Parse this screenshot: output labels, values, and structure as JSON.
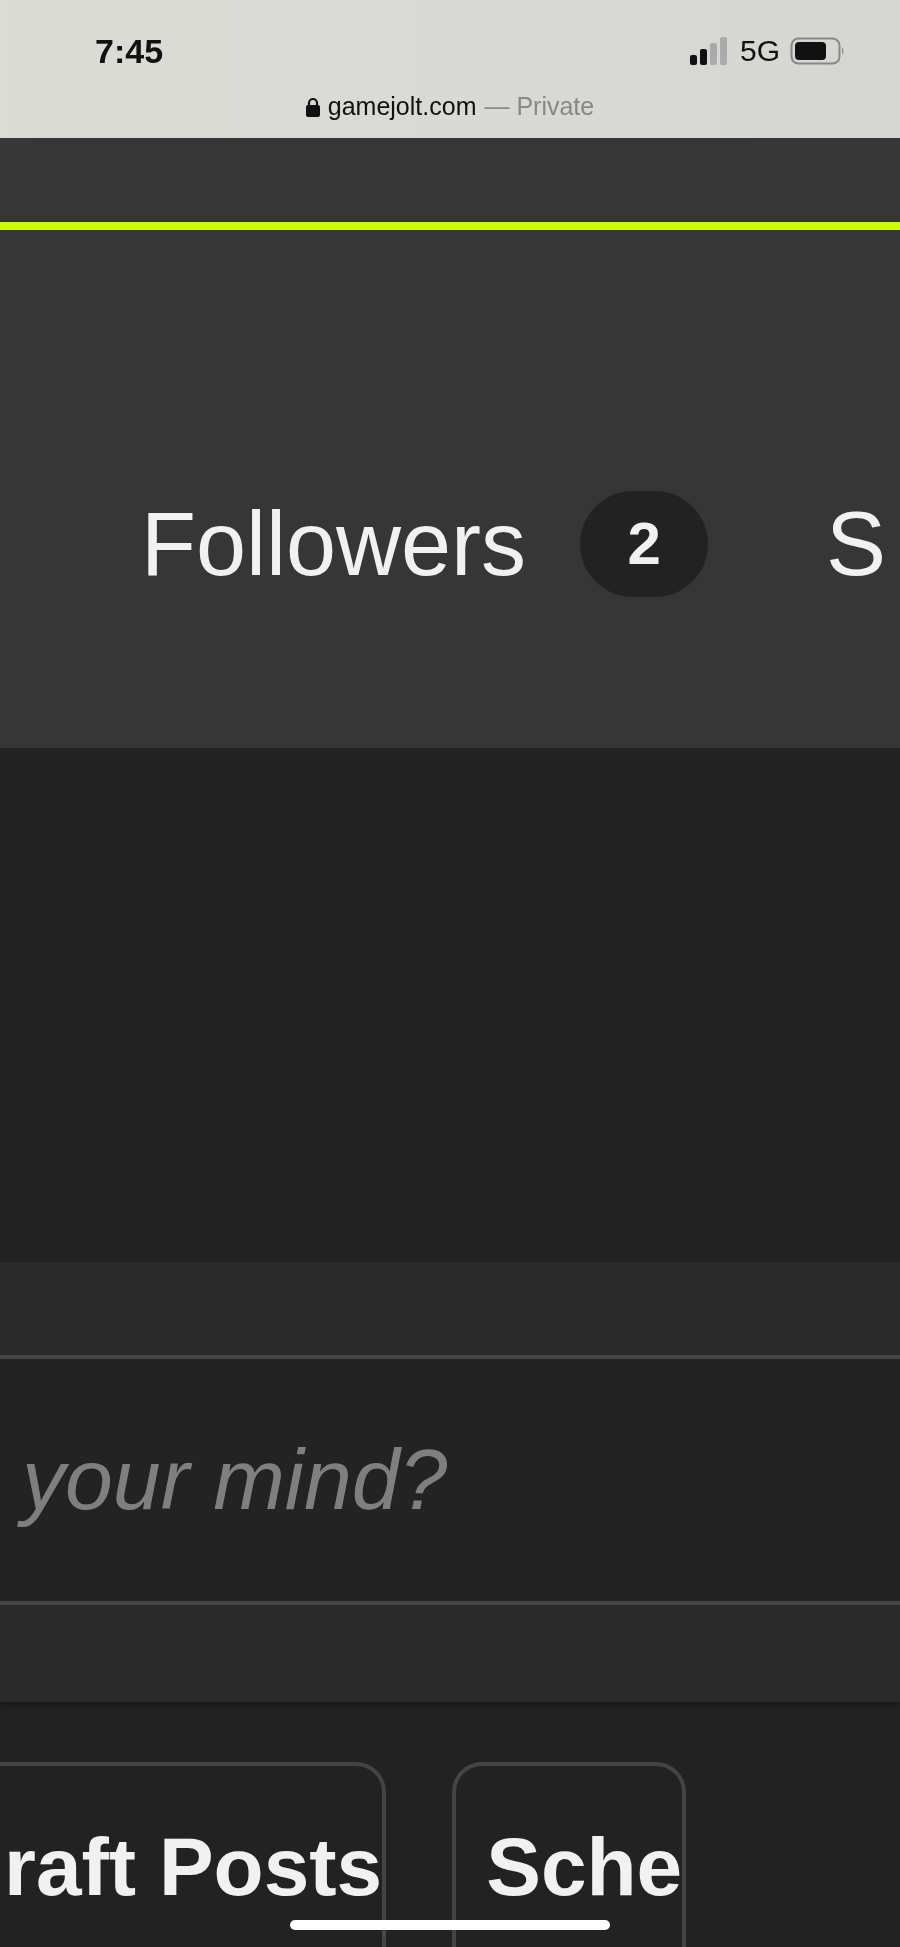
{
  "status_bar": {
    "time": "7:45",
    "network": "5G"
  },
  "address_bar": {
    "domain": "gamejolt.com",
    "mode": "— Private"
  },
  "profile_nav": {
    "tabs": [
      {
        "label": "Followers",
        "count": "2"
      },
      {
        "label": "S"
      }
    ]
  },
  "post_box": {
    "placeholder": "your mind?"
  },
  "post_tabs": [
    {
      "label": "raft Posts"
    },
    {
      "label": "Sche"
    }
  ]
}
